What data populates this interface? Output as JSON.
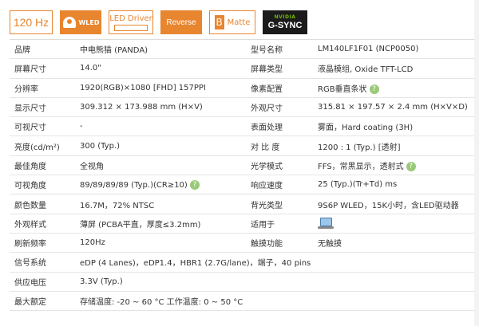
{
  "badges": {
    "refresh": "120 Hz",
    "wled": "WLED",
    "led_driver": "LED Driver",
    "reverse": "Reverse",
    "matte": "Matte",
    "matte_glyph": "B",
    "gsync_brand": "NVIDIA",
    "gsync": "G-SYNC"
  },
  "colors": {
    "accent": "#e8852f",
    "help_icon": "#9ac979",
    "gsync_bg": "#1b1b1b"
  },
  "help_glyph": "?",
  "specs": {
    "r1": {
      "l": "品牌",
      "v": "中电熊猫 (PANDA)",
      "l2": "型号名称",
      "v2": "LM140LF1F01 (NCP0050)"
    },
    "r2": {
      "l": "屏幕尺寸",
      "v": "14.0\"",
      "l2": "屏幕类型",
      "v2": "液晶模组,  Oxide TFT-LCD"
    },
    "r3": {
      "l": "分辨率",
      "v": "1920(RGB)×1080  [FHD]  157PPI",
      "l2": "像素配置",
      "v2": "RGB垂直条状"
    },
    "r4": {
      "l": "显示尺寸",
      "v": "309.312 × 173.988 mm (H×V)",
      "l2": "外观尺寸",
      "v2": "315.81 × 197.57 × 2.4 mm (H×V×D)"
    },
    "r5": {
      "l": "可视尺寸",
      "v": "-",
      "l2": "表面处理",
      "v2": "雾面，Hard coating (3H)"
    },
    "r6": {
      "l": "亮度(cd/m²)",
      "v": "300 (Typ.)",
      "l2": "对 比 度",
      "v2": "1200 : 1 (Typ.) [透射]"
    },
    "r7": {
      "l": "最佳角度",
      "v": "全视角",
      "l2": "光学模式",
      "v2": "FFS，常黑显示，透射式"
    },
    "r8": {
      "l": "可视角度",
      "v": "89/89/89/89 (Typ.)(CR≥10)",
      "l2": "响应速度",
      "v2": "25 (Typ.)(Tr+Td) ms"
    },
    "r9": {
      "l": "颜色数量",
      "v": "16.7M，72% NTSC",
      "l2": "背光类型",
      "v2": "9S6P WLED，15K小时，含LED驱动器"
    },
    "r10": {
      "l": "外观样式",
      "v": "薄屏 (PCBA平直，厚度≤3.2mm)",
      "l2": "适用于",
      "v2": ""
    },
    "r11": {
      "l": "刷新频率",
      "v": "120Hz",
      "l2": "触摸功能",
      "v2": "无触摸"
    },
    "r12": {
      "l": "信号系统",
      "v": "eDP (4 Lanes)，eDP1.4，HBR1 (2.7G/lane)，端子，40 pins"
    },
    "r13": {
      "l": "供应电压",
      "v": "3.3V (Typ.)"
    },
    "r14": {
      "l": "最大额定",
      "v": "存储温度: -20 ~ 60 °C    工作温度: 0 ~ 50 °C"
    }
  }
}
